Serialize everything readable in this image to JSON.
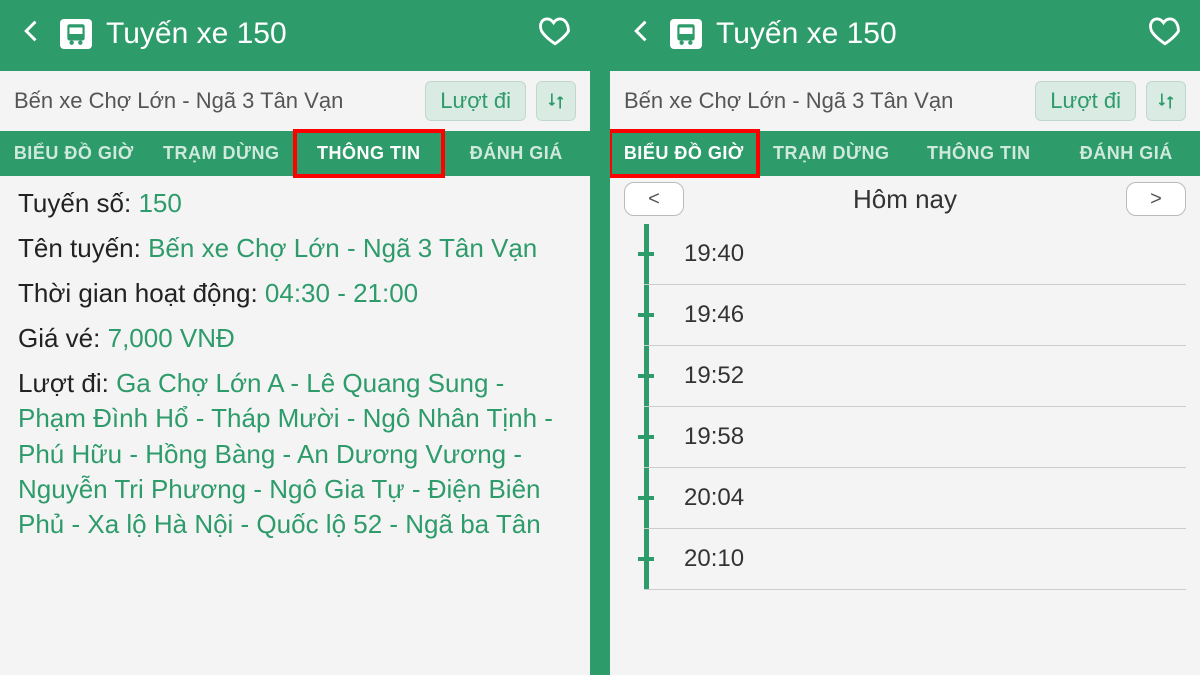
{
  "header": {
    "title": "Tuyến xe 150"
  },
  "route": {
    "name": "Bến xe Chợ Lớn - Ngã 3 Tân Vạn",
    "direction_label": "Lượt đi"
  },
  "tabs": {
    "schedule": "BIỂU ĐỒ GIỜ",
    "stops": "TRẠM DỪNG",
    "info": "THÔNG TIN",
    "reviews": "ĐÁNH GIÁ"
  },
  "info": {
    "route_no_label": "Tuyến số:",
    "route_no": "150",
    "route_name_label": "Tên tuyến:",
    "route_name": "Bến xe Chợ Lớn - Ngã 3 Tân Vạn",
    "hours_label": "Thời gian hoạt động:",
    "hours": "04:30 - 21:00",
    "fare_label": "Giá vé:",
    "fare": "7,000 VNĐ",
    "go_label": "Lượt đi:",
    "go_route": "Ga Chợ Lớn A - Lê Quang Sung - Phạm Đình Hổ - Tháp Mười - Ngô Nhân Tịnh - Phú Hữu - Hồng Bàng - An Dương Vương - Nguyễn Tri Phương - Ngô Gia Tự - Điện Biên Phủ - Xa lộ Hà Nội - Quốc lộ 52 - Ngã ba Tân"
  },
  "schedule": {
    "day_label": "Hôm nay",
    "prev": "<",
    "next": ">",
    "times": [
      "19:40",
      "19:46",
      "19:52",
      "19:58",
      "20:04",
      "20:10"
    ]
  }
}
